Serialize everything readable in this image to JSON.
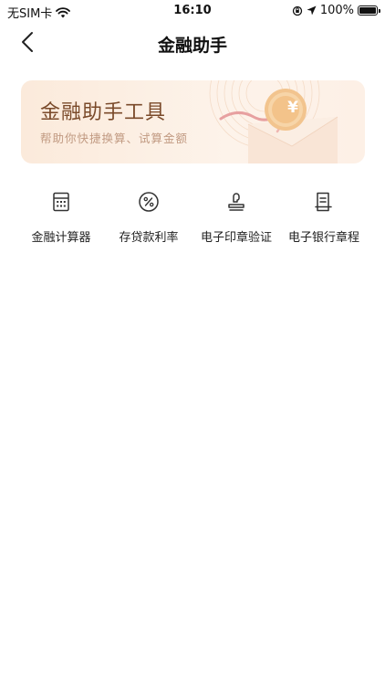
{
  "status_bar": {
    "carrier": "无SIM卡",
    "time": "16:10",
    "battery": "100%"
  },
  "nav": {
    "title": "金融助手"
  },
  "banner": {
    "title": "金融助手工具",
    "subtitle": "帮助你快捷换算、试算金额",
    "coin_symbol": "¥"
  },
  "tools": [
    {
      "label": "金融计算器",
      "icon": "calculator-icon"
    },
    {
      "label": "存贷款利率",
      "icon": "percent-icon"
    },
    {
      "label": "电子印章验证",
      "icon": "stamp-icon"
    },
    {
      "label": "电子银行章程",
      "icon": "document-icon"
    }
  ],
  "colors": {
    "banner_title": "#7a4a2a",
    "banner_subtitle": "#c19a82",
    "icon_stroke": "#333333"
  }
}
